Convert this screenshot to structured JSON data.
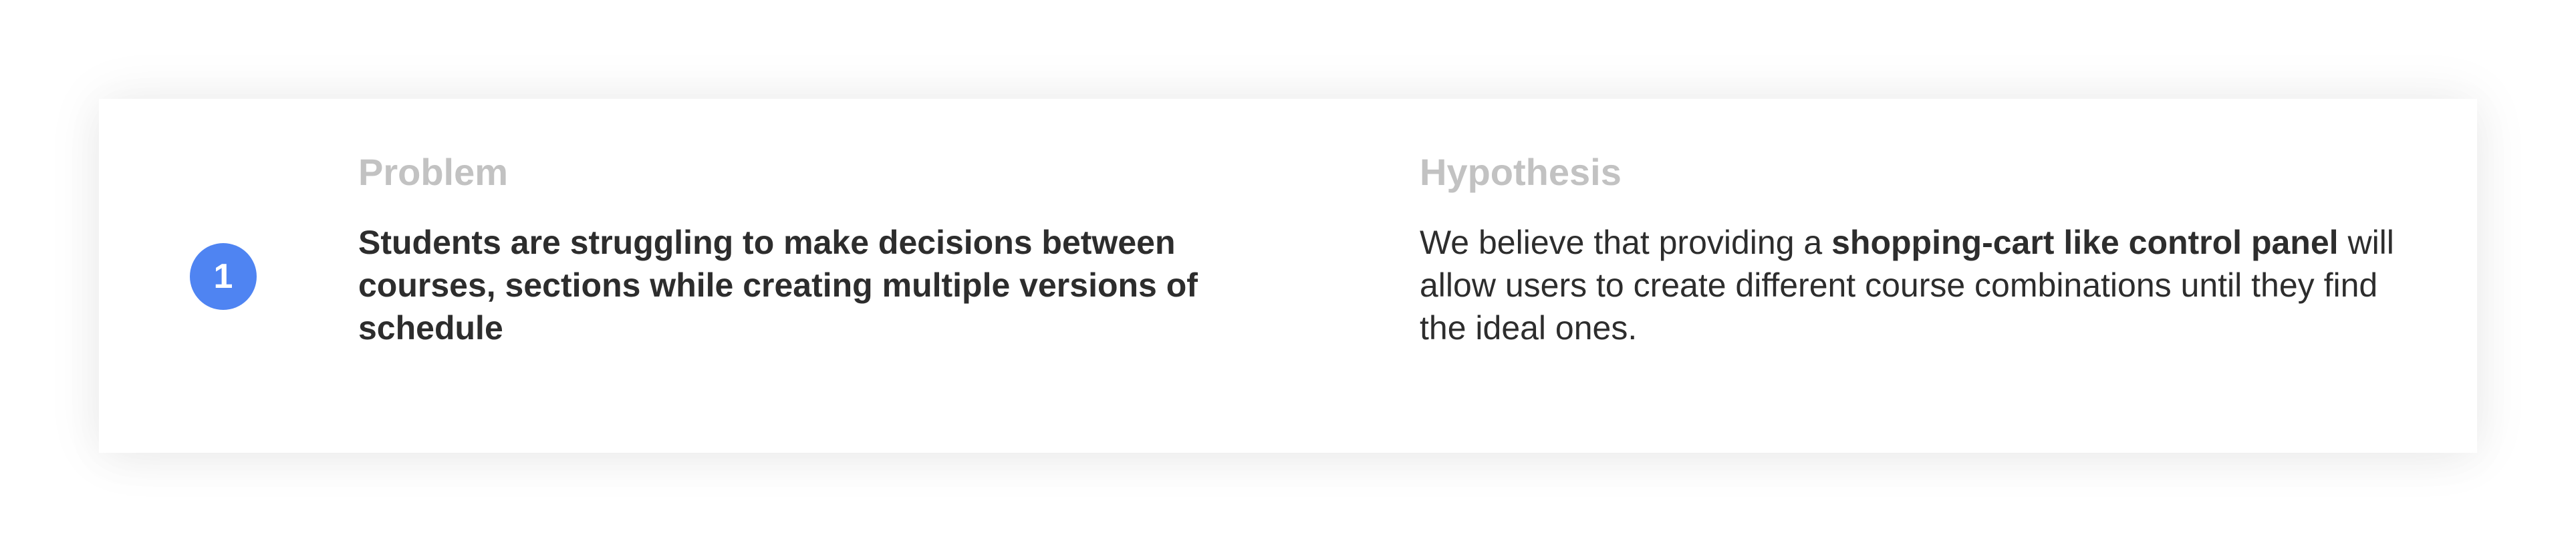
{
  "step": {
    "number": "1"
  },
  "problem": {
    "heading": "Problem",
    "text": "Students are struggling to make decisions between courses, sections while creating multiple versions of schedule"
  },
  "hypothesis": {
    "heading": "Hypothesis",
    "text_before": "We believe that providing a ",
    "text_emphasis": "shopping-cart like control panel",
    "text_after": " will allow users to create different course combinations until they find the ideal ones."
  },
  "colors": {
    "accent": "#4f84f2",
    "heading": "#c2c2c2",
    "body_text": "#2d2d2d",
    "card_background": "#ffffff"
  }
}
